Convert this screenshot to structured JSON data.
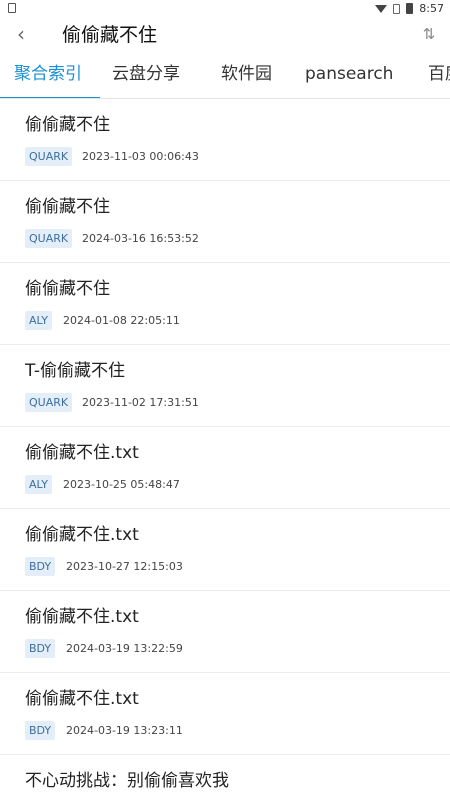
{
  "status_bar": {
    "time": "8:57"
  },
  "app_bar": {
    "title": "偷偷藏不住",
    "back_icon": "chevron-left-icon",
    "sort_icon": "sort-arrows-icon"
  },
  "tabs": [
    {
      "label": "聚合索引",
      "active": true
    },
    {
      "label": "云盘分享",
      "active": false
    },
    {
      "label": "软件园",
      "active": false
    },
    {
      "label": "pansearch",
      "active": false
    },
    {
      "label": "百度",
      "active": false
    }
  ],
  "colors": {
    "accent": "#1a8fd6",
    "badge_bg": "#e3eef8",
    "badge_text": "#3d6e9e"
  },
  "results": [
    {
      "title": "偷偷藏不住",
      "source": "QUARK",
      "time": "2023-11-03 00:06:43"
    },
    {
      "title": "偷偷藏不住",
      "source": "QUARK",
      "time": "2024-03-16 16:53:52"
    },
    {
      "title": "偷偷藏不住",
      "source": "ALY",
      "time": "2024-01-08 22:05:11"
    },
    {
      "title": "T-偷偷藏不住",
      "source": "QUARK",
      "time": "2023-11-02 17:31:51"
    },
    {
      "title": "偷偷藏不住.txt",
      "source": "ALY",
      "time": "2023-10-25 05:48:47"
    },
    {
      "title": "偷偷藏不住.txt",
      "source": "BDY",
      "time": "2023-10-27 12:15:03"
    },
    {
      "title": "偷偷藏不住.txt",
      "source": "BDY",
      "time": "2024-03-19 13:22:59"
    },
    {
      "title": "偷偷藏不住.txt",
      "source": "BDY",
      "time": "2024-03-19 13:23:11"
    },
    {
      "title": "不心动挑战：别偷偷喜欢我",
      "source": "",
      "time": ""
    }
  ]
}
